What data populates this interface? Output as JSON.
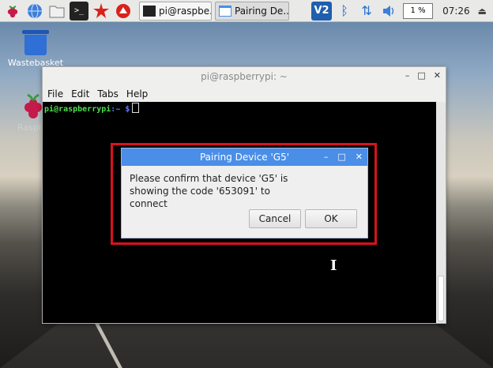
{
  "taskbar": {
    "apps": [
      {
        "icon": "raspberry-menu-icon"
      },
      {
        "icon": "web-browser-icon"
      },
      {
        "icon": "file-manager-icon"
      },
      {
        "icon": "terminal-icon"
      },
      {
        "icon": "mathematica-icon"
      },
      {
        "icon": "wolfram-icon"
      }
    ],
    "windows": [
      {
        "label": "pi@raspbe...",
        "icon": "terminal-window-icon"
      },
      {
        "label": "Pairing De...",
        "icon": "dialog-window-icon"
      }
    ],
    "tray": {
      "vnc_label": "V2",
      "cpu": "1 %",
      "clock": "07:26"
    }
  },
  "desktop": {
    "icons": [
      {
        "label": "Wastebasket"
      },
      {
        "label": "Raspb..."
      }
    ]
  },
  "terminal": {
    "title": "pi@raspberrypi: ~",
    "menu": [
      "File",
      "Edit",
      "Tabs",
      "Help"
    ],
    "prompt_host": "pi@raspberrypi",
    "prompt_path": ":~ $"
  },
  "dialog": {
    "title": "Pairing Device 'G5'",
    "message_line1": "Please confirm that device 'G5' is",
    "message_line2": "showing the code '653091' to connect",
    "cancel_label": "Cancel",
    "ok_label": "OK"
  },
  "colors": {
    "dialog_title_bg": "#4a8ee8",
    "highlight": "#d8121e",
    "terminal_bg": "#000000",
    "prompt_green": "#4fe04f"
  }
}
